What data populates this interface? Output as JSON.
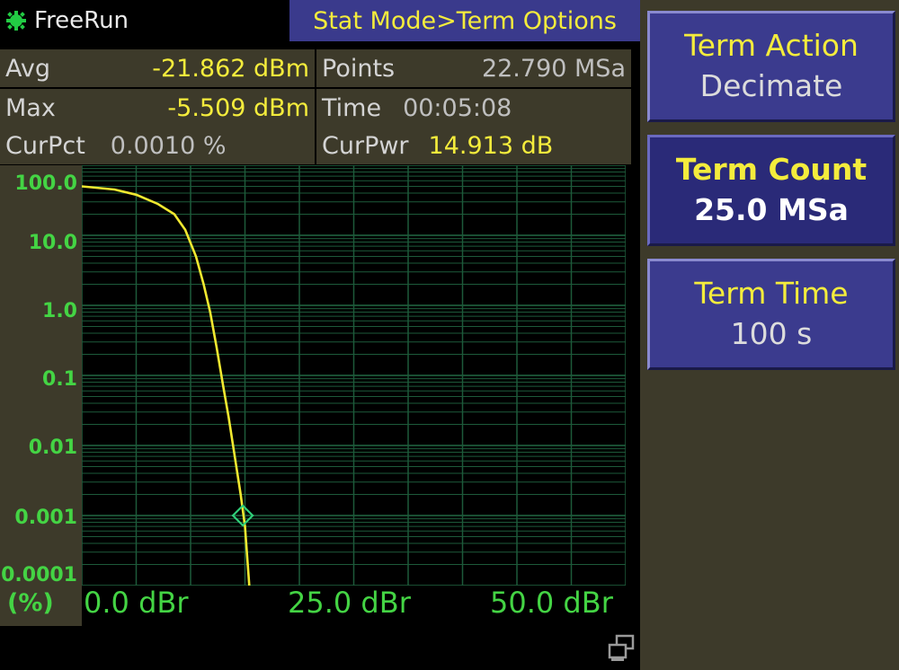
{
  "status": {
    "run_state": "FreeRun",
    "run_icon": "gear-icon"
  },
  "menu_path": "Stat Mode>Term Options",
  "readouts": {
    "avg": {
      "label": "Avg",
      "value": "-21.862 dBm"
    },
    "max": {
      "label": "Max",
      "value": "-5.509 dBm"
    },
    "curpct": {
      "label": "CurPct",
      "value": "0.0010 %"
    },
    "points": {
      "label": "Points",
      "value": "22.790 MSa"
    },
    "time": {
      "label": "Time",
      "value": "00:05:08"
    },
    "curpwr": {
      "label": "CurPwr",
      "value": "14.913 dB"
    }
  },
  "softkeys": [
    {
      "title": "Term Action",
      "value": "Decimate"
    },
    {
      "title": "Term Count",
      "value": "25.0 MSa"
    },
    {
      "title": "Term Time",
      "value": "100 s"
    }
  ],
  "colors": {
    "trace": "#f0e830",
    "grid": "#1d5a3a",
    "axis_text": "#44d444",
    "marker": "#2fd07a"
  },
  "chart_data": {
    "type": "line",
    "y_scale": "log",
    "ylim": [
      0.0001,
      100.0
    ],
    "xlim": [
      0,
      50
    ],
    "y_tick_labels": [
      "100.0",
      "10.0",
      "1.0",
      "0.1",
      "0.01",
      "0.001",
      "0.0001"
    ],
    "x_tick_labels": [
      "0.0 dBr",
      "25.0 dBr",
      "50.0 dBr"
    ],
    "y_unit_label": "(%)",
    "grid": true,
    "series": [
      {
        "x": [
          0,
          3,
          5,
          7,
          8.5,
          9.5,
          10.5,
          11.2,
          11.8,
          12.4,
          13.0,
          13.5,
          14.0,
          14.6,
          15.0,
          15.4
        ],
        "y": [
          50,
          45,
          38,
          28,
          20,
          12,
          5,
          2,
          0.8,
          0.25,
          0.07,
          0.025,
          0.008,
          0.002,
          0.0007,
          0.0001
        ]
      }
    ],
    "marker": {
      "x": 14.8,
      "y": 0.001
    }
  }
}
